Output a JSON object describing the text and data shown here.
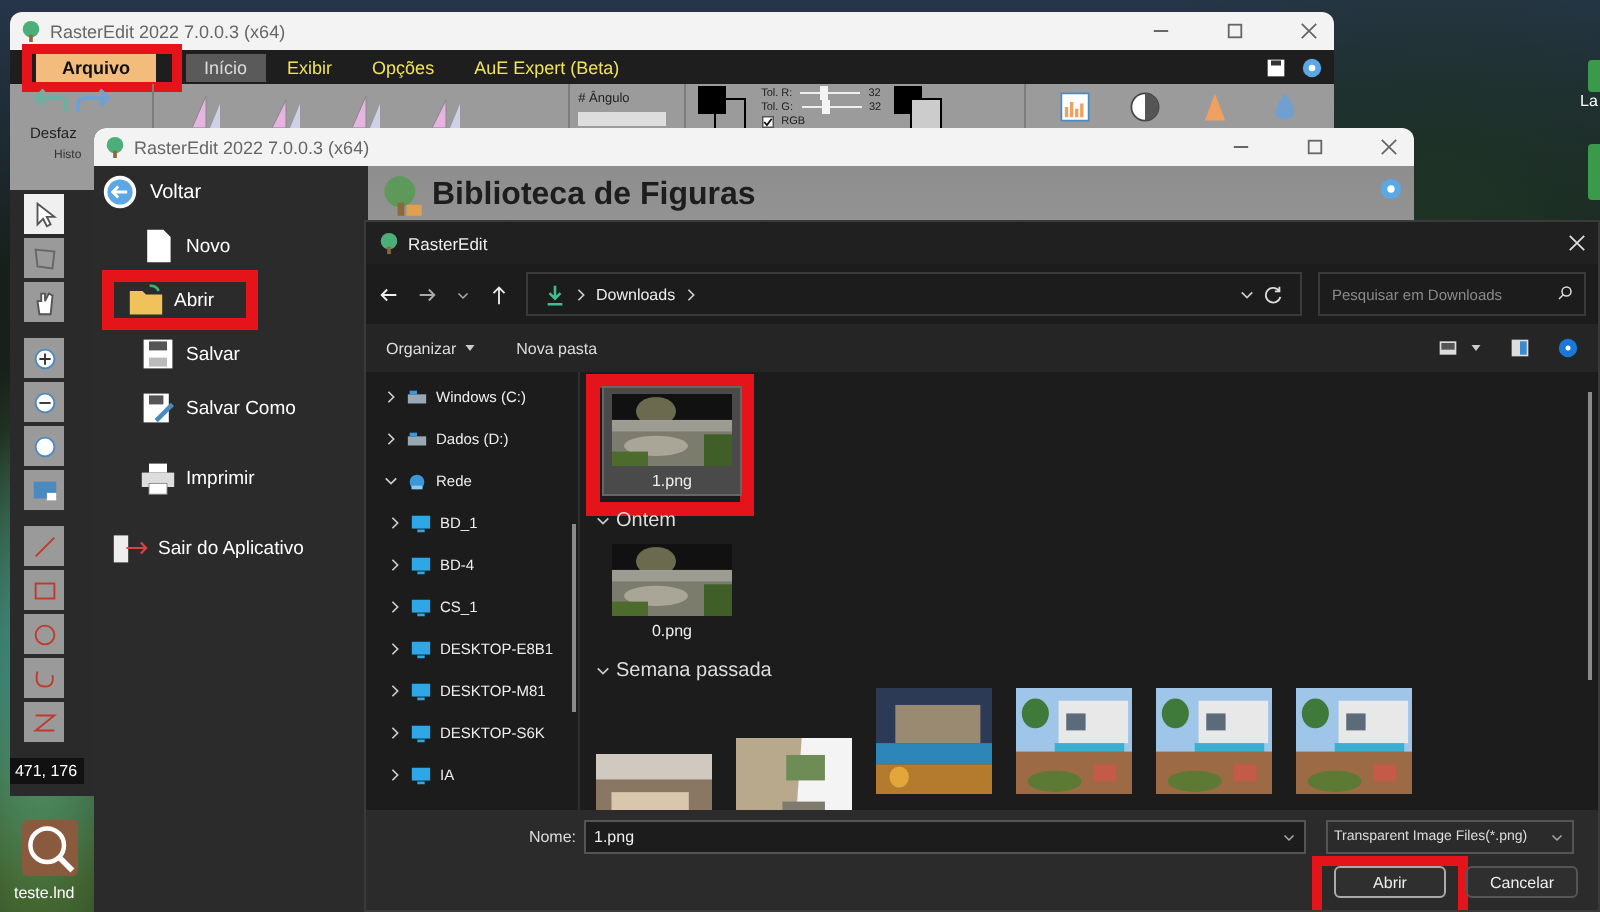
{
  "desktop": {
    "icons": [
      {
        "label": "La"
      },
      {
        "label": "teste.lnd"
      }
    ]
  },
  "main_window": {
    "title": "RasterEdit 2022 7.0.0.3 (x64)",
    "menu": [
      {
        "label": "Arquivo",
        "kind": "file",
        "selected": false,
        "highlighted": true
      },
      {
        "label": "Início",
        "kind": "tab",
        "selected": true,
        "highlighted": false
      },
      {
        "label": "Exibir",
        "kind": "tab",
        "selected": false,
        "highlighted": false
      },
      {
        "label": "Opções",
        "kind": "tab",
        "selected": false,
        "highlighted": false
      },
      {
        "label": "AuE Expert (Beta)",
        "kind": "tab",
        "selected": false,
        "highlighted": false
      }
    ],
    "ribbon": {
      "undo_label": "Desfaz",
      "group_label": "Histo",
      "angle_label": "# Ângulo",
      "tolerance": [
        {
          "label": "Tol. R:",
          "reading": "32",
          "level": 0.4
        },
        {
          "label": "Tol. G:",
          "reading": "32",
          "level": 0.4
        }
      ],
      "rgb": {
        "label": "RGB",
        "checked": true
      }
    },
    "tools": [
      {
        "selected": true
      },
      {
        "selected": false
      },
      {
        "selected": false
      },
      {
        "selected": false
      },
      {
        "selected": false
      },
      {
        "selected": false
      },
      {
        "selected": false
      },
      {
        "selected": false
      },
      {
        "selected": false
      },
      {
        "selected": false
      },
      {
        "selected": false
      },
      {
        "selected": false
      }
    ],
    "coordinates": "471, 176"
  },
  "backstage": {
    "title": "RasterEdit 2022 7.0.0.3 (x64)",
    "back_label": "Voltar",
    "items": [
      {
        "label": "Novo",
        "highlighted": false
      },
      {
        "label": "Abrir",
        "highlighted": true
      },
      {
        "label": "Salvar",
        "highlighted": false
      },
      {
        "label": "Salvar Como",
        "highlighted": false
      },
      {
        "label": "Imprimir",
        "highlighted": false
      },
      {
        "label": "Sair do Aplicativo",
        "highlighted": false
      }
    ],
    "heading": "Biblioteca de Figuras"
  },
  "dialog": {
    "title": "RasterEdit",
    "path": "Downloads",
    "search": {
      "placeholder": "Pesquisar em Downloads"
    },
    "toolbar": [
      "Organizar",
      "Nova pasta"
    ],
    "nav": [
      {
        "label": "Windows (C:)",
        "kind": "drive",
        "expanded": false
      },
      {
        "label": "Dados (D:)",
        "kind": "drive",
        "expanded": false
      },
      {
        "label": "Rede",
        "kind": "network",
        "expanded": true,
        "children": [
          {
            "label": "BD_1",
            "kind": "computer",
            "expanded": false
          },
          {
            "label": "BD-4",
            "kind": "computer",
            "expanded": false
          },
          {
            "label": "CS_1",
            "kind": "computer",
            "expanded": false
          },
          {
            "label": "DESKTOP-E8B1",
            "kind": "computer",
            "expanded": false
          },
          {
            "label": "DESKTOP-M81",
            "kind": "computer",
            "expanded": false
          },
          {
            "label": "DESKTOP-S6K",
            "kind": "computer",
            "expanded": false
          },
          {
            "label": "IA",
            "kind": "computer",
            "expanded": false
          }
        ]
      }
    ],
    "groups": [
      {
        "items": [
          {
            "name": "1.png",
            "kind": "file",
            "selected": true,
            "highlighted": true
          }
        ]
      },
      {
        "header": "Ontem",
        "items": [
          {
            "name": "0.png",
            "kind": "file",
            "selected": false,
            "highlighted": false
          }
        ]
      },
      {
        "header": "Semana passada"
      }
    ],
    "file_label": "Nome:",
    "file_name": "1.png",
    "filter": "Transparent Image Files(*.png)",
    "buttons": [
      {
        "label": "Abrir",
        "kind": "primary",
        "highlighted": true
      },
      {
        "label": "Cancelar",
        "kind": "secondary",
        "highlighted": false
      }
    ]
  }
}
